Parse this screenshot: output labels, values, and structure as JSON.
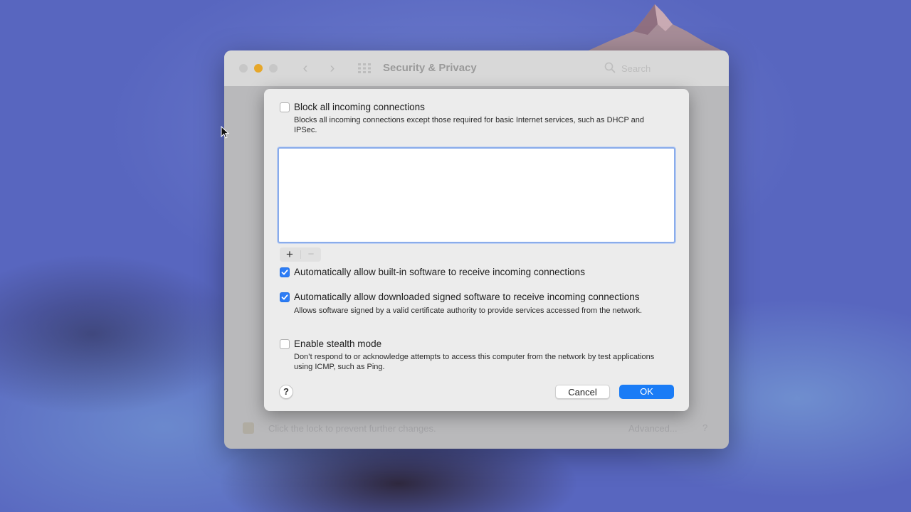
{
  "window": {
    "title": "Security & Privacy",
    "search_placeholder": "Search",
    "footer_lock_text": "Click the lock to prevent further changes.",
    "advanced_label": "Advanced...",
    "help_label": "?"
  },
  "dialog": {
    "block_all": {
      "label": "Block all incoming connections",
      "checked": false,
      "description": "Blocks all incoming connections except those required for basic Internet services, such as DHCP and IPSec."
    },
    "app_list": [],
    "add_label": "+",
    "remove_label": "−",
    "allow_builtin": {
      "label": "Automatically allow built-in software to receive incoming connections",
      "checked": true
    },
    "allow_signed": {
      "label": "Automatically allow downloaded signed software to receive incoming connections",
      "checked": true,
      "description": "Allows software signed by a valid certificate authority to provide services accessed from the network."
    },
    "stealth_mode": {
      "label": "Enable stealth mode",
      "checked": false,
      "description": "Don’t respond to or acknowledge attempts to access this computer from the network by test applications using ICMP, such as Ping."
    },
    "help_label": "?",
    "cancel_label": "Cancel",
    "ok_label": "OK"
  },
  "colors": {
    "accent": "#1a7cf6",
    "checkbox_on": "#2c7cf5",
    "minimize_button": "#e6a72a"
  }
}
